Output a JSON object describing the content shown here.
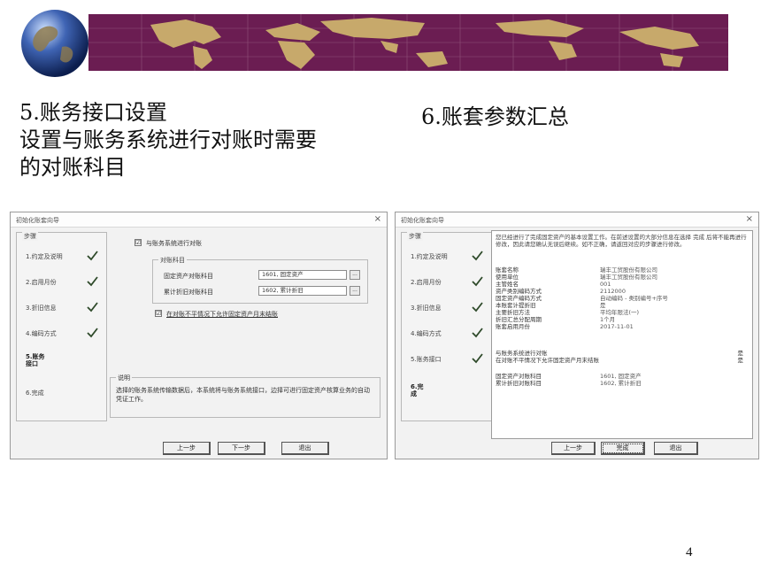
{
  "slide": {
    "heading_left": [
      "5.账务接口设置",
      "设置与账务系统进行对账时需要",
      "的对账科目"
    ],
    "heading_right": "6.账套参数汇总",
    "page_number": "4"
  },
  "colors": {
    "banner": "#6b1d52",
    "map_land": "#c7a96b",
    "check": "#2e4a2a"
  },
  "icons": [
    "globe-icon",
    "world-map",
    "check-icon",
    "close-icon",
    "browse-icon"
  ],
  "dialog_left": {
    "title": "初始化账套向导",
    "close": "×",
    "steps_caption": "步骤",
    "steps": [
      {
        "label": "1.约定及说明",
        "done": true
      },
      {
        "label": "2.启用月份",
        "done": true
      },
      {
        "label": "3.折旧信息",
        "done": true
      },
      {
        "label": "4.编码方式",
        "done": true
      },
      {
        "label": "5.账务接口",
        "done": false,
        "current": true
      },
      {
        "label": "6.完成",
        "done": false
      }
    ],
    "checkbox_link": {
      "checked": "☑",
      "label": "与账务系统进行对账"
    },
    "group_caption": "对账科目",
    "fields": [
      {
        "label": "固定资产对账科目",
        "value": "1601, 固定资产"
      },
      {
        "label": "累计折旧对账科目",
        "value": "1602, 累计折旧"
      }
    ],
    "browse": "...",
    "checkbox_allow": {
      "checked": "☑",
      "label": "在对账不平情况下允许固定资产月末结账"
    },
    "explain_caption": "说明",
    "explain_text": "选择的账务系统传输数据后，本系统将与账务系统接口，边择可进行固定资产核算业务的自动凭证工作。",
    "buttons": {
      "prev": "上一步",
      "next": "下一步",
      "exit": "退出"
    }
  },
  "dialog_right": {
    "title": "初始化账套向导",
    "close": "×",
    "steps_caption": "步骤",
    "steps": [
      {
        "label": "1.约定及说明",
        "done": true
      },
      {
        "label": "2.启用月份",
        "done": true
      },
      {
        "label": "3.折旧信息",
        "done": true
      },
      {
        "label": "4.编码方式",
        "done": true
      },
      {
        "label": "5.账务接口",
        "done": true
      },
      {
        "label": "6.完成",
        "done": false,
        "current": true
      }
    ],
    "intro": "您已经进行了完成固定资产的基本设置工作。在前述设置的大部分信息在选择 完成 后将不能再进行修改，因此请您确认无误后继续。如不正确，请返回对应的步骤进行修改。",
    "summary_rows": [
      {
        "k": "账套名称",
        "v": "瑞丰工贸股份有限公司"
      },
      {
        "k": "使用单位",
        "v": "瑞丰工贸股份有限公司"
      },
      {
        "k": "主管姓名",
        "v": "001"
      },
      {
        "k": "资产类别编码方式",
        "v": "2112000"
      },
      {
        "k": "固定资产编码方式",
        "v": "自动编码 - 类别编号+序号"
      },
      {
        "k": "本账套计提折旧",
        "v": "是"
      },
      {
        "k": "主要折旧方法",
        "v": "平均年限法(一)"
      },
      {
        "k": "折旧汇总分配周期",
        "v": "1个月"
      },
      {
        "k": "账套启用月份",
        "v": "2017-11-01"
      }
    ],
    "summary_rows2": [
      {
        "k": "与账务系统进行对账",
        "v": "是"
      },
      {
        "k": "在对账不平情况下允许固定资产月末结账",
        "v": "是"
      }
    ],
    "summary_rows3": [
      {
        "k": "固定资产对账科目",
        "v": "1601, 固定资产"
      },
      {
        "k": "累计折旧对账科目",
        "v": "1602, 累计折旧"
      }
    ],
    "buttons": {
      "prev": "上一步",
      "finish": "完成",
      "exit": "退出"
    }
  }
}
